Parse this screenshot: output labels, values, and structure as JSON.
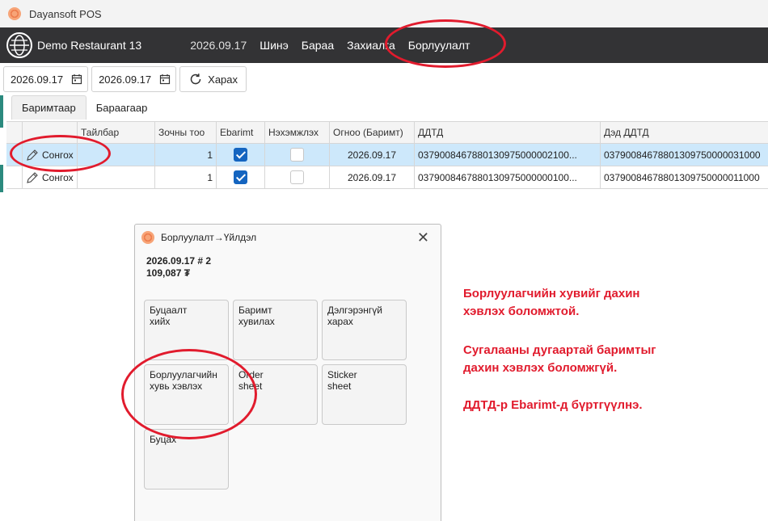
{
  "window": {
    "title": "Dayansoft POS",
    "icon": "app-logo-icon"
  },
  "header": {
    "restaurant": "Demo Restaurant 13",
    "date": "2026.09.17",
    "nav": [
      "Шинэ",
      "Бараа",
      "Захиалга",
      "Борлуулалт"
    ]
  },
  "toolbar": {
    "date_from": "2026.09.17",
    "date_to": "2026.09.17",
    "refresh_label": "Харах"
  },
  "tabs": [
    "Баримтаар",
    "Бараагаар"
  ],
  "grid": {
    "columns": [
      "",
      "Тайлбар",
      "Зочны тоо",
      "Ebarimt",
      "Нэхэмжлэх",
      "Огноо (Баримт)",
      "ДДТД",
      "Дэд ДДТД"
    ],
    "rows": [
      {
        "select_label": "Сонгох",
        "description": "",
        "guests": "1",
        "ebarimt": true,
        "invoice": false,
        "date": "2026.09.17",
        "ddtd": "0379008467880130975000002100...",
        "sub_ddtd": "03790084678801309750000031000",
        "selected": true
      },
      {
        "select_label": "Сонгох",
        "description": "",
        "guests": "1",
        "ebarimt": true,
        "invoice": false,
        "date": "2026.09.17",
        "ddtd": "0379008467880130975000000100...",
        "sub_ddtd": "03790084678801309750000011000",
        "selected": false
      }
    ]
  },
  "dialog": {
    "title": "Борлуулалт→Үйлдэл",
    "info_line1": "2026.09.17  # 2",
    "info_line2": "109,087 ₮",
    "buttons": [
      "Буцаалт\nхийх",
      "Баримт\nхувилах",
      "Дэлгэрэнгүй\nхарах",
      "Борлуулагчийн\nхувь хэвлэх",
      "Order\nsheet",
      "Sticker\nsheet",
      "Буцах"
    ]
  },
  "annotations": {
    "color": "#e11b2d",
    "note1": "Борлуулагчийн хувийг дахин\nхэвлэх боломжтой.",
    "note2": "Сугалааны дугаартай баримтыг\nдахин хэвлэх боломжгүй.",
    "note3": "ДДТД-р Ebarimt-д бүртгүүлнэ."
  },
  "colors": {
    "header_bg": "#333335",
    "selected_row": "#cde8fb",
    "checkbox": "#1565c0"
  }
}
